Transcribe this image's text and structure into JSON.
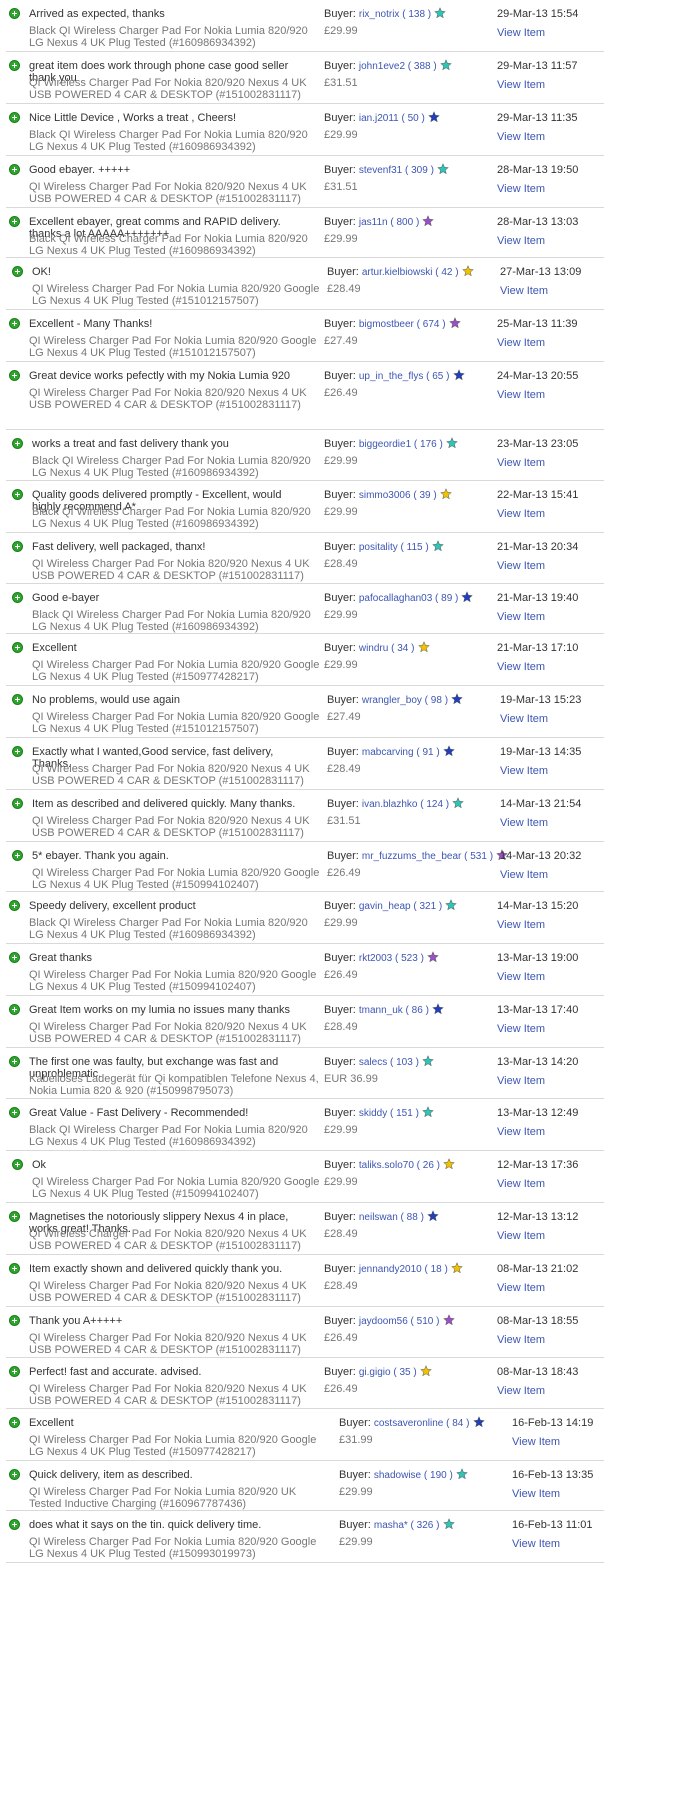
{
  "labels": {
    "buyer": "Buyer:",
    "view_item": "View Item"
  },
  "star_colors": {
    "turquoise": "#2ec4b6",
    "blue": "#1f3fbf",
    "purple": "#9b4fc7",
    "yellow": "#f2c200"
  },
  "feedback": [
    {
      "comment": "Arrived as expected, thanks",
      "item": "Black QI Wireless Charger Pad For Nokia Lumia 820/920 LG Nexus 4 UK Plug Tested (#160986934392)",
      "buyer": "rix_notrix",
      "score": "138",
      "star": "turquoise",
      "price": "£29.99",
      "date": "29-Mar-13 15:54"
    },
    {
      "comment": "great item does work through phone case good seller thank you",
      "item": "QI Wireless Charger Pad For Nokia 820/920 Nexus 4 UK USB POWERED 4 CAR & DESKTOP (#151002831117)",
      "buyer": "john1eve2",
      "score": "388",
      "star": "turquoise",
      "price": "£31.51",
      "date": "29-Mar-13 11:57"
    },
    {
      "comment": "Nice Little Device , Works a treat , Cheers!",
      "item": "Black QI Wireless Charger Pad For Nokia Lumia 820/920 LG Nexus 4 UK Plug Tested (#160986934392)",
      "buyer": "ian.j2011",
      "score": "50",
      "star": "blue",
      "price": "£29.99",
      "date": "29-Mar-13 11:35"
    },
    {
      "comment": "Good ebayer. +++++",
      "item": "QI Wireless Charger Pad For Nokia 820/920 Nexus 4 UK USB POWERED 4 CAR & DESKTOP (#151002831117)",
      "buyer": "stevenf31",
      "score": "309",
      "star": "turquoise",
      "price": "£31.51",
      "date": "28-Mar-13 19:50"
    },
    {
      "comment": "Excellent ebayer, great comms and RAPID delivery. thanks a lot AAAAA+++++++",
      "item": "Black QI Wireless Charger Pad For Nokia Lumia 820/920 LG Nexus 4 UK Plug Tested (#160986934392)",
      "buyer": "jas11n",
      "score": "800",
      "star": "purple",
      "price": "£29.99",
      "date": "28-Mar-13 13:03"
    },
    {
      "comment": "OK!",
      "item": "QI Wireless Charger Pad For Nokia Lumia 820/920 Google LG Nexus 4 UK Plug Tested (#151012157507)",
      "buyer": "artur.kielbiowski",
      "score": "42",
      "star": "yellow",
      "price": "£28.49",
      "date": "27-Mar-13 13:09"
    },
    {
      "comment": "Excellent - Many Thanks!",
      "item": "QI Wireless Charger Pad For Nokia Lumia 820/920 Google LG Nexus 4 UK Plug Tested (#151012157507)",
      "buyer": "bigmostbeer",
      "score": "674",
      "star": "purple",
      "price": "£27.49",
      "date": "25-Mar-13 11:39"
    },
    {
      "comment": "Great device works pefectly with my Nokia Lumia 920",
      "item": "QI Wireless Charger Pad For Nokia 820/920 Nexus 4 UK USB POWERED 4 CAR & DESKTOP (#151002831117)",
      "buyer": "up_in_the_flys",
      "score": "65",
      "star": "blue",
      "price": "£26.49",
      "date": "24-Mar-13 20:55"
    },
    {
      "comment": "works a treat and fast delivery thank you",
      "item": "Black QI Wireless Charger Pad For Nokia Lumia 820/920 LG Nexus 4 UK Plug Tested (#160986934392)",
      "buyer": "biggeordie1",
      "score": "176",
      "star": "turquoise",
      "price": "£29.99",
      "date": "23-Mar-13 23:05"
    },
    {
      "comment": "Quality goods delivered promptly - Excellent, would highly recommend A*",
      "item": "Black QI Wireless Charger Pad For Nokia Lumia 820/920 LG Nexus 4 UK Plug Tested (#160986934392)",
      "buyer": "simmo3006",
      "score": "39",
      "star": "yellow",
      "price": "£29.99",
      "date": "22-Mar-13 15:41"
    },
    {
      "comment": "Fast delivery, well packaged, thanx!",
      "item": "QI Wireless Charger Pad For Nokia 820/920 Nexus 4 UK USB POWERED 4 CAR & DESKTOP (#151002831117)",
      "buyer": "positality",
      "score": "115",
      "star": "turquoise",
      "price": "£28.49",
      "date": "21-Mar-13 20:34"
    },
    {
      "comment": "Good e-bayer",
      "item": "Black QI Wireless Charger Pad For Nokia Lumia 820/920 LG Nexus 4 UK Plug Tested (#160986934392)",
      "buyer": "pafocallaghan03",
      "score": "89",
      "star": "blue",
      "price": "£29.99",
      "date": "21-Mar-13 19:40"
    },
    {
      "comment": "Excellent",
      "item": "QI Wireless Charger Pad For Nokia Lumia 820/920 Google LG Nexus 4 UK Plug Tested (#150977428217)",
      "buyer": "windru",
      "score": "34",
      "star": "yellow",
      "price": "£29.99",
      "date": "21-Mar-13 17:10"
    },
    {
      "comment": "No problems, would use again",
      "item": "QI Wireless Charger Pad For Nokia Lumia 820/920 Google LG Nexus 4 UK Plug Tested (#151012157507)",
      "buyer": "wrangler_boy",
      "score": "98",
      "star": "blue",
      "price": "£27.49",
      "date": "19-Mar-13 15:23"
    },
    {
      "comment": "Exactly what I wanted,Good service, fast delivery, Thanks.",
      "item": "QI Wireless Charger Pad For Nokia 820/920 Nexus 4 UK USB POWERED 4 CAR & DESKTOP (#151002831117)",
      "buyer": "mabcarving",
      "score": "91",
      "star": "blue",
      "price": "£28.49",
      "date": "19-Mar-13 14:35"
    },
    {
      "comment": "Item as described and delivered quickly. Many thanks.",
      "item": "QI Wireless Charger Pad For Nokia 820/920 Nexus 4 UK USB POWERED 4 CAR & DESKTOP (#151002831117)",
      "buyer": "ivan.blazhko",
      "score": "124",
      "star": "turquoise",
      "price": "£31.51",
      "date": "14-Mar-13 21:54"
    },
    {
      "comment": "5* ebayer. Thank you again.",
      "item": "QI Wireless Charger Pad For Nokia Lumia 820/920 Google LG Nexus 4 UK Plug Tested (#150994102407)",
      "buyer": "mr_fuzzums_the_bear",
      "score": "531",
      "star": "purple",
      "price": "£26.49",
      "date": "14-Mar-13 20:32"
    },
    {
      "comment": "Speedy delivery, excellent product",
      "item": "Black QI Wireless Charger Pad For Nokia Lumia 820/920 LG Nexus 4 UK Plug Tested (#160986934392)",
      "buyer": "gavin_heap",
      "score": "321",
      "star": "turquoise",
      "price": "£29.99",
      "date": "14-Mar-13 15:20"
    },
    {
      "comment": "Great thanks",
      "item": "QI Wireless Charger Pad For Nokia Lumia 820/920 Google LG Nexus 4 UK Plug Tested (#150994102407)",
      "buyer": "rkt2003",
      "score": "523",
      "star": "purple",
      "price": "£26.49",
      "date": "13-Mar-13 19:00"
    },
    {
      "comment": "Great Item works on my lumia no issues many thanks",
      "item": "QI Wireless Charger Pad For Nokia 820/920 Nexus 4 UK USB POWERED 4 CAR & DESKTOP (#151002831117)",
      "buyer": "tmann_uk",
      "score": "86",
      "star": "blue",
      "price": "£28.49",
      "date": "13-Mar-13 17:40"
    },
    {
      "comment": "The first one was faulty, but exchange was fast and unproblematic.",
      "item": "Kabelloses Ladegerät für Qi kompatiblen Telefone Nexus 4, Nokia Lumia 820 & 920 (#150998795073)",
      "buyer": "salecs",
      "score": "103",
      "star": "turquoise",
      "price": "EUR 36.99",
      "date": "13-Mar-13 14:20"
    },
    {
      "comment": "Great Value - Fast Delivery - Recommended!",
      "item": "Black QI Wireless Charger Pad For Nokia Lumia 820/920 LG Nexus 4 UK Plug Tested (#160986934392)",
      "buyer": "skiddy",
      "score": "151",
      "star": "turquoise",
      "price": "£29.99",
      "date": "13-Mar-13 12:49"
    },
    {
      "comment": "Ok",
      "item": "QI Wireless Charger Pad For Nokia Lumia 820/920 Google LG Nexus 4 UK Plug Tested (#150994102407)",
      "buyer": "taliks.solo70",
      "score": "26",
      "star": "yellow",
      "price": "£29.99",
      "date": "12-Mar-13 17:36"
    },
    {
      "comment": "Magnetises the notoriously slippery Nexus 4 in place, works great! Thanks.",
      "item": "QI Wireless Charger Pad For Nokia 820/920 Nexus 4 UK USB POWERED 4 CAR & DESKTOP (#151002831117)",
      "buyer": "neilswan",
      "score": "88",
      "star": "blue",
      "price": "£28.49",
      "date": "12-Mar-13 13:12"
    },
    {
      "comment": "Item exactly shown and delivered quickly thank you.",
      "item": "QI Wireless Charger Pad For Nokia 820/920 Nexus 4 UK USB POWERED 4 CAR & DESKTOP (#151002831117)",
      "buyer": "jennandy2010",
      "score": "18",
      "star": "yellow",
      "price": "£28.49",
      "date": "08-Mar-13 21:02"
    },
    {
      "comment": "Thank you A+++++",
      "item": "QI Wireless Charger Pad For Nokia 820/920 Nexus 4 UK USB POWERED 4 CAR & DESKTOP (#151002831117)",
      "buyer": "jaydoom56",
      "score": "510",
      "star": "purple",
      "price": "£26.49",
      "date": "08-Mar-13 18:55"
    },
    {
      "comment": "Perfect! fast and accurate. advised.",
      "item": "QI Wireless Charger Pad For Nokia 820/920 Nexus 4 UK USB POWERED 4 CAR & DESKTOP (#151002831117)",
      "buyer": "gi.gigio",
      "score": "35",
      "star": "yellow",
      "price": "£26.49",
      "date": "08-Mar-13 18:43"
    },
    {
      "comment": "Excellent",
      "item": "QI Wireless Charger Pad For Nokia Lumia 820/920 Google LG Nexus 4 UK Plug Tested (#150977428217)",
      "buyer": "costsaveronline",
      "score": "84",
      "star": "blue",
      "price": "£31.99",
      "date": "16-Feb-13 14:19"
    },
    {
      "comment": "Quick delivery, item as described.",
      "item": "QI Wireless Charger Pad For Nokia Lumia 820/920 UK Tested Inductive Charging (#160967787436)",
      "buyer": "shadowise",
      "score": "190",
      "star": "turquoise",
      "price": "£29.99",
      "date": "16-Feb-13 13:35"
    },
    {
      "comment": "does what it says on the tin. quick delivery time.",
      "item": "QI Wireless Charger Pad For Nokia Lumia 820/920 Google LG Nexus 4 UK Plug Tested (#150993019973)",
      "buyer": "masha*",
      "score": "326",
      "star": "turquoise",
      "price": "£29.99",
      "date": "16-Feb-13 11:01"
    }
  ]
}
